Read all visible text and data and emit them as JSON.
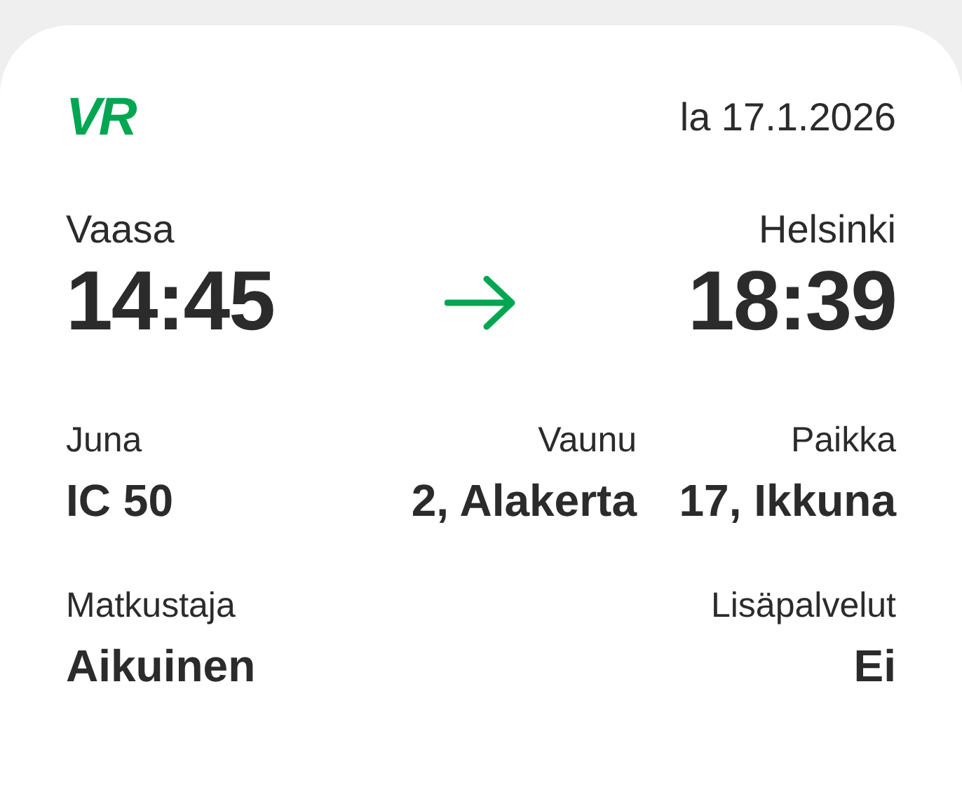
{
  "logo": "VR",
  "date": "la 17.1.2026",
  "departure": {
    "station": "Vaasa",
    "time": "14:45"
  },
  "arrival": {
    "station": "Helsinki",
    "time": "18:39"
  },
  "details": [
    {
      "label": "Juna",
      "value": "IC 50"
    },
    {
      "label": "Vaunu",
      "value": "2, Alakerta"
    },
    {
      "label": "Paikka",
      "value": "17, Ikkuna"
    }
  ],
  "details2": [
    {
      "label": "Matkustaja",
      "value": "Aikuinen"
    },
    {
      "label": "Lisäpalvelut",
      "value": "Ei"
    }
  ]
}
